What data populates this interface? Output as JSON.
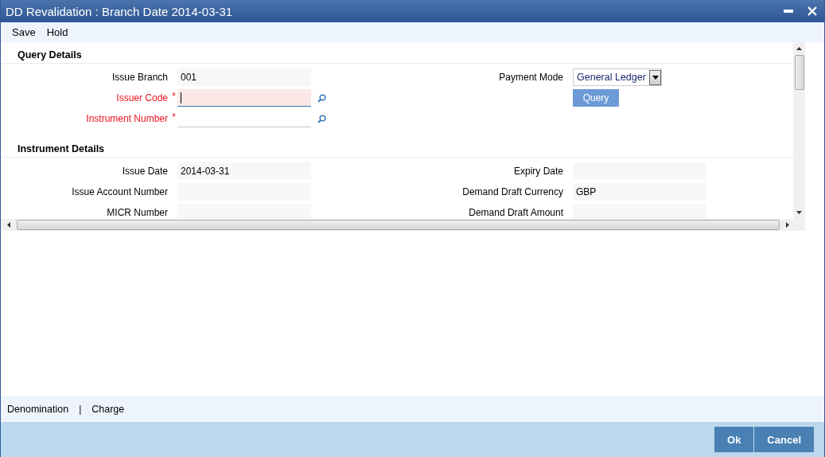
{
  "window": {
    "title": "DD Revalidation : Branch Date 2014-03-31"
  },
  "toolbar": [
    "Save",
    "Hold"
  ],
  "required_marker": "*",
  "sections": [
    {
      "title": "Query Details",
      "left": [
        {
          "label": "Issue Branch",
          "kind": "text",
          "value": "001",
          "required": false
        },
        {
          "label": "Issuer Code",
          "kind": "lookup",
          "required": true,
          "focused": true
        },
        {
          "label": "Instrument Number",
          "kind": "lookup",
          "required": true
        }
      ],
      "right": [
        {
          "label": "Payment Mode",
          "kind": "select",
          "value": "General Ledger",
          "required": false
        },
        {
          "label": "Query",
          "kind": "button"
        }
      ]
    },
    {
      "title": "Instrument Details",
      "left": [
        {
          "label": "Issue Date",
          "kind": "text",
          "value": "2014-03-31",
          "required": false
        },
        {
          "label": "Issue Account Number",
          "kind": "text",
          "required": false
        },
        {
          "label": "MICR Number",
          "kind": "text",
          "required": false
        }
      ],
      "right": [
        {
          "label": "Expiry Date",
          "kind": "text",
          "required": false
        },
        {
          "label": "Demand Draft Currency",
          "kind": "text",
          "value": "GBP",
          "required": false
        },
        {
          "label": "Demand Draft Amount",
          "kind": "text",
          "required": false
        }
      ]
    }
  ],
  "links": {
    "items": [
      "Denomination",
      "Charge"
    ],
    "separator": "|"
  },
  "buttons": [
    "Ok",
    "Cancel"
  ]
}
